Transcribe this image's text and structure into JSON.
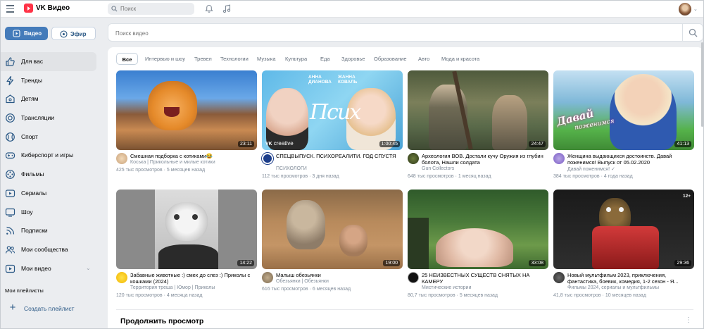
{
  "app": {
    "title": "VK Видео"
  },
  "topbar": {
    "search_placeholder": "Поиск"
  },
  "sidebar": {
    "video_button": "Видео",
    "efir_button": "Эфир",
    "items": [
      {
        "label": "Для вас",
        "icon": "thumbs-up-icon",
        "active": true
      },
      {
        "label": "Тренды",
        "icon": "lightning-icon"
      },
      {
        "label": "Детям",
        "icon": "kids-icon"
      },
      {
        "label": "Трансляции",
        "icon": "broadcast-icon"
      },
      {
        "label": "Спорт",
        "icon": "sport-icon"
      },
      {
        "label": "Киберспорт и игры",
        "icon": "gamepad-icon"
      },
      {
        "label": "Фильмы",
        "icon": "film-icon"
      },
      {
        "label": "Сериалы",
        "icon": "series-icon"
      },
      {
        "label": "Шоу",
        "icon": "tv-icon"
      },
      {
        "label": "Подписки",
        "icon": "subscriptions-icon"
      },
      {
        "label": "Мои сообщества",
        "icon": "communities-icon"
      },
      {
        "label": "Мои видео",
        "icon": "my-video-icon",
        "chevron": true
      }
    ],
    "playlists_title": "Мои плейлисты",
    "create_playlist": "Создать плейлист"
  },
  "main": {
    "search_placeholder": "Поиск видео",
    "chips": [
      "Все",
      "Интервью и шоу",
      "Тревел",
      "Технологии",
      "Музыка",
      "Культура",
      "Еда",
      "Здоровье",
      "Образование",
      "Авто",
      "Мода и красота"
    ],
    "videos": [
      {
        "title": "Смешная подборка с котиками😂",
        "channel": "Коська | Прикольные и милые котики",
        "views": "425 тыс просмотров",
        "ago": "5 месяцев назад",
        "duration": "23:11"
      },
      {
        "title": "СПЕЦВЫПУСК. ПСИХОРЕАЛИТИ. ГОД СПУСТЯ",
        "channel": "ПСИХОЛОГИ",
        "views": "112 тыс просмотров",
        "ago": "3 дня назад",
        "duration": "1:00:45",
        "thumb_text_1": "АННА ДИАНОВА",
        "thumb_text_2": "ЖАННА КОВАЛЬ",
        "thumb_watermark": "creative"
      },
      {
        "title": "Археология ВОВ. Достали кучу Оружия из глубин болота, Нашли солдата",
        "channel": "Gun Collectors",
        "views": "648 тыс просмотров",
        "ago": "1 месяц назад",
        "duration": "24:47"
      },
      {
        "title": "Женщина выдающихся достоинств. Давай поженимся! Выпуск от 05.02.2020",
        "channel": "Давай поженимся! ✓",
        "views": "384 тыс просмотров",
        "ago": "4 года назад",
        "duration": "41:13",
        "thumb_text_1": "Давай",
        "thumb_text_2": "поженимся"
      },
      {
        "title": "Забавные животные :) смех до слез :) Приколы с кошками (2024)",
        "channel": "Территория треша | Юмор | Приколы",
        "views": "120 тыс просмотров",
        "ago": "4 месяца назад",
        "duration": "14:22"
      },
      {
        "title": "Малыш обезьянки",
        "channel": "Обезьянки | Обезьянки",
        "views": "616 тыс просмотров",
        "ago": "6 месяцев назад",
        "duration": "19:00"
      },
      {
        "title": "25 НЕИЗВЕСТНЫХ СУЩЕСТВ СНЯТЫХ НА КАМЕРУ",
        "channel": "Мистические истории",
        "views": "80,7 тыс просмотров",
        "ago": "5 месяцев назад",
        "duration": "33:08"
      },
      {
        "title": "Новый мультфильм 2023, приключения, фантастика, боевик, комедия, 1-2 сезон - Я...",
        "channel": "Фильмы 2024, сериалы и мультфильмы",
        "views": "41,8 тыс просмотров",
        "ago": "10 месяцев назад",
        "duration": "29:36",
        "age_badge": "12+"
      }
    ],
    "continue_title": "Продолжить просмотр",
    "meta_separator": " · "
  },
  "colors": {
    "accent": "#447bba",
    "brand": "#ff3347",
    "background": "#ebedf0"
  }
}
